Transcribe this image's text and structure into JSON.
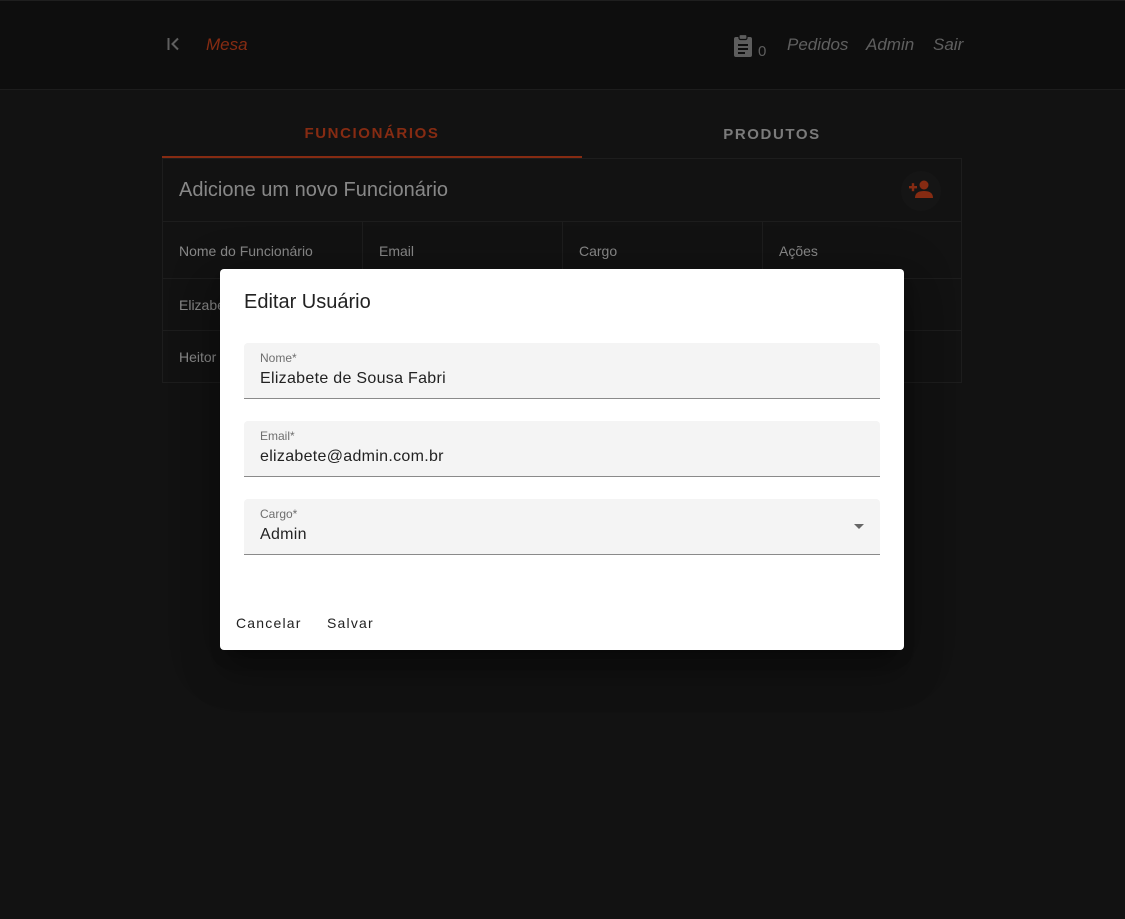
{
  "header": {
    "brand": "Mesa",
    "cart_count": "0",
    "nav": [
      "Pedidos",
      "Admin",
      "Sair"
    ]
  },
  "tabs": [
    {
      "label": "FUNCIONÁRIOS",
      "active": true
    },
    {
      "label": "PRODUTOS",
      "active": false
    }
  ],
  "card": {
    "title": "Adicione um novo Funcionário",
    "columns": [
      "Nome do Funcionário",
      "Email",
      "Cargo",
      "Ações"
    ],
    "rows": [
      {
        "name": "Elizabe"
      },
      {
        "name": "Heitor"
      }
    ]
  },
  "dialog": {
    "title": "Editar Usuário",
    "fields": {
      "name": {
        "label": "Nome*",
        "value": "Elizabete de Sousa Fabri"
      },
      "email": {
        "label": "Email*",
        "value": "elizabete@admin.com.br"
      },
      "role": {
        "label": "Cargo*",
        "value": "Admin"
      }
    },
    "cancel": "Cancelar",
    "save": "Salvar"
  },
  "colors": {
    "accent": "#c6401b",
    "background": "#1b1b1b"
  }
}
